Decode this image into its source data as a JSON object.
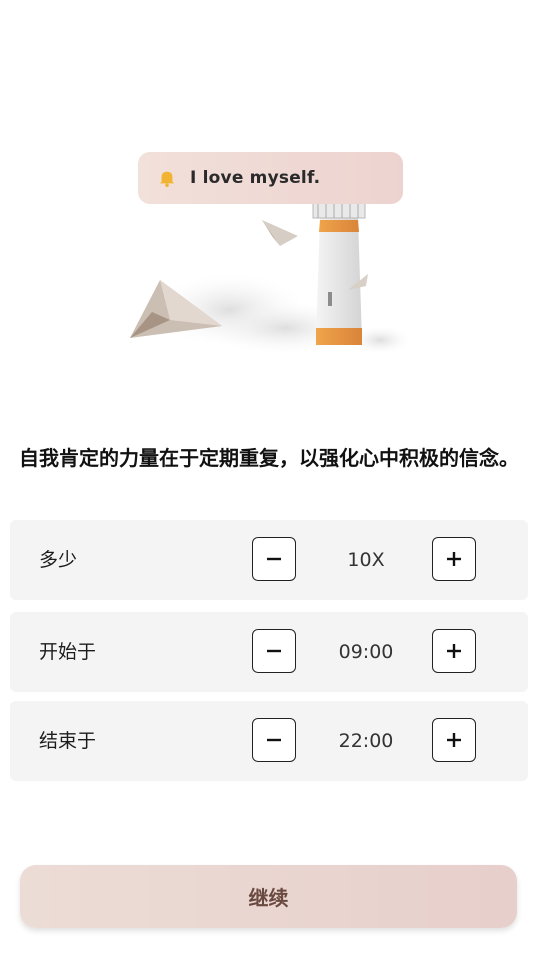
{
  "hero": {
    "bubble_text": "I love myself.",
    "bell_icon": "bell-icon",
    "accent_color": "#f2b333"
  },
  "headline": "自我肯定的力量在于定期重复，以强化心中积极的信念。",
  "settings": [
    {
      "label": "多少",
      "value": "10X"
    },
    {
      "label": "开始于",
      "value": "09:00"
    },
    {
      "label": "结束于",
      "value": "22:00"
    }
  ],
  "continue_label": "继续"
}
